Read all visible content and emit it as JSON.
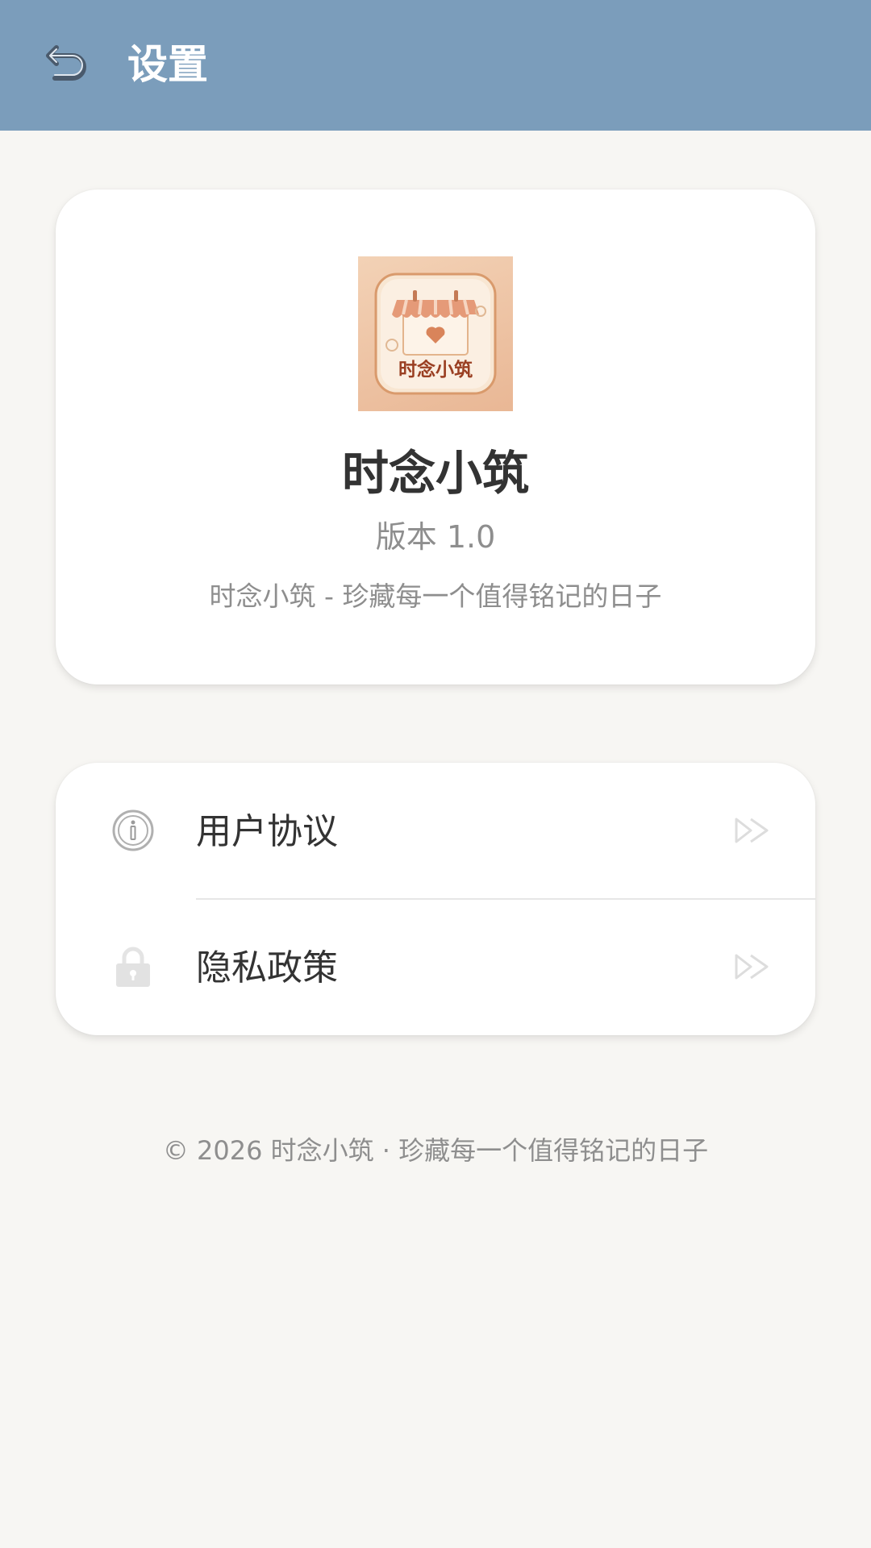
{
  "header": {
    "title": "设置",
    "back_icon": "undo-arrow-icon",
    "background": "#7b9dbb"
  },
  "app_info": {
    "logo_text": "时念小筑",
    "name": "时念小筑",
    "version": "版本 1.0",
    "tagline": "时念小筑 - 珍藏每一个值得铭记的日子"
  },
  "menu": {
    "items": [
      {
        "label": "用户协议",
        "icon": "info-icon",
        "arrow_icon": "double-arrow-right-icon"
      },
      {
        "label": "隐私政策",
        "icon": "lock-icon",
        "arrow_icon": "double-arrow-right-icon"
      }
    ]
  },
  "footer": {
    "text": "© 2026 时念小筑 · 珍藏每一个值得铭记的日子"
  }
}
